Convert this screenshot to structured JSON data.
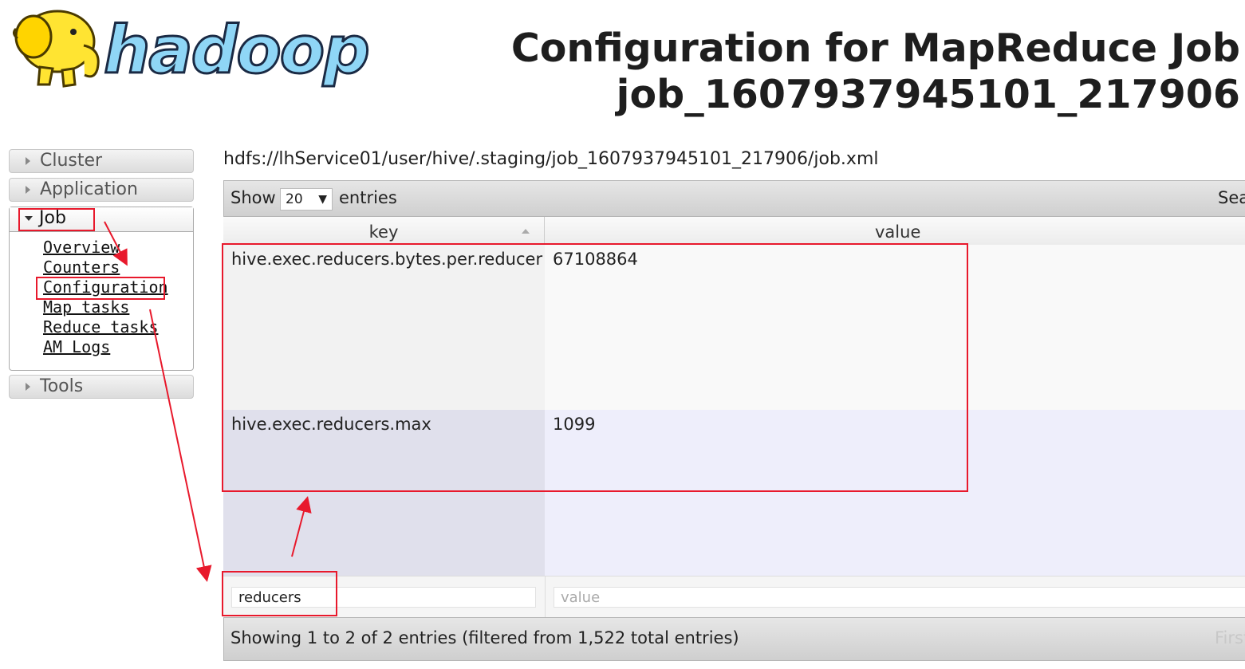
{
  "logo": {
    "text": "hadoop"
  },
  "title": {
    "line1": "Configuration for MapReduce Job",
    "line2": "job_1607937945101_217906"
  },
  "sidebar": {
    "cluster": "Cluster",
    "application": "Application",
    "job": "Job",
    "job_links": [
      "Overview",
      "Counters",
      "Configuration",
      "Map tasks",
      "Reduce tasks",
      "AM Logs"
    ],
    "tools": "Tools"
  },
  "main": {
    "path": "hdfs://lhService01/user/hive/.staging/job_1607937945101_217906/job.xml",
    "show_label": "Show",
    "page_size": "20",
    "entries_label": "entries",
    "search_label": "Sea",
    "columns": {
      "key": "key",
      "value": "value"
    },
    "rows": [
      {
        "key": "hive.exec.reducers.bytes.per.reducer",
        "value": "67108864"
      },
      {
        "key": "hive.exec.reducers.max",
        "value": "1099"
      }
    ],
    "filter_key_value": "reducers",
    "filter_value_placeholder": "value",
    "info": "Showing 1 to 2 of 2 entries (filtered from 1,522 total entries)",
    "first_label": "First"
  },
  "colors": {
    "annotation_red": "#e8192c",
    "row_odd_key": "#f2f2f2",
    "row_odd_value": "#f9f9f9",
    "row_even_key": "#e0e0ec",
    "row_even_value": "#eeeefb"
  }
}
